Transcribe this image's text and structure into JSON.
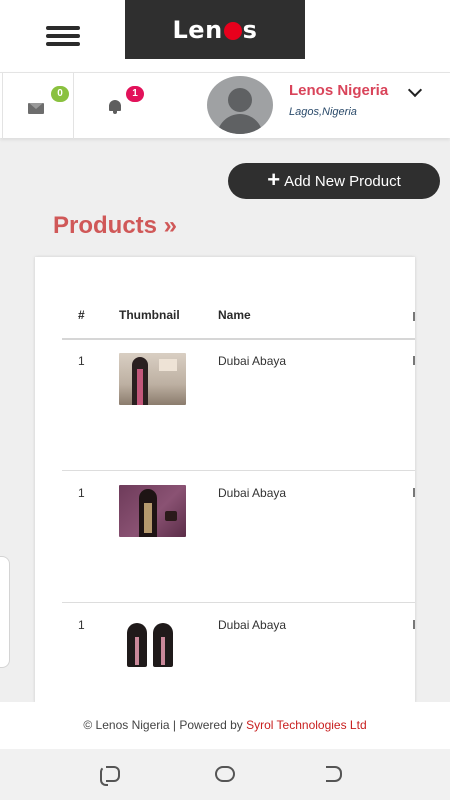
{
  "header": {
    "menu_icon": "hamburger-menu-icon",
    "logo_text_left": "Len",
    "logo_text_right": "s"
  },
  "user_bar": {
    "messages_icon": "envelope-icon",
    "messages_count": "0",
    "messages_badge_color": "#8ac13f",
    "notifications_icon": "bell-icon",
    "notifications_count": "1",
    "notifications_badge_color": "#e2125a",
    "user_name": "Lenos Nigeria",
    "user_location": "Lagos,Nigeria",
    "dropdown_icon": "chevron-down-icon"
  },
  "actions": {
    "add_product_label": "Add New Product",
    "add_icon": "plus-icon"
  },
  "page": {
    "title": "Products »",
    "title_color": "#d05858"
  },
  "table": {
    "columns": [
      "#",
      "Thumbnail",
      "Name"
    ],
    "rows": [
      {
        "index": "1",
        "name": "Dubai Abaya"
      },
      {
        "index": "1",
        "name": "Dubai Abaya"
      },
      {
        "index": "1",
        "name": "Dubai Abaya"
      }
    ]
  },
  "footer": {
    "text": "© Lenos Nigeria | Powered by ",
    "link_text": "Syrol Technologies Ltd",
    "link_color": "#c81e1e"
  },
  "system_nav": {
    "recent_icon": "recent-apps-icon",
    "home_icon": "home-icon",
    "back_icon": "back-icon"
  }
}
